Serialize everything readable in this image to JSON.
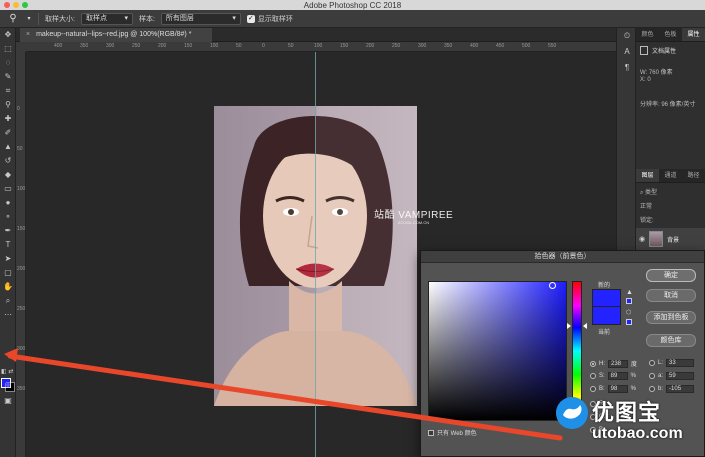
{
  "app": {
    "title": "Adobe Photoshop CC 2018"
  },
  "options_bar": {
    "sample_size_label": "取样大小:",
    "sample_size_value": "取样点",
    "sample_label": "样本:",
    "sample_value": "所有图层",
    "show_ring_label": "显示取样环",
    "show_ring_checked": true
  },
  "document": {
    "tab_title": "makeup--natural--lips--red.jpg @ 100%(RGB/8#) *",
    "tab_close": "×",
    "ruler_h": [
      "400",
      "350",
      "300",
      "250",
      "200",
      "150",
      "100",
      "50",
      "0",
      "50",
      "100",
      "150",
      "200",
      "250",
      "300",
      "350",
      "400",
      "450",
      "500",
      "550"
    ],
    "ruler_v": [
      "0",
      "50",
      "100",
      "150",
      "200",
      "250",
      "300",
      "350"
    ],
    "watermark": "站酷 VAMPIREE",
    "watermark_sub": "ZCOOL.COM.CN"
  },
  "panels": {
    "top_tabs": [
      "颜色",
      "色板",
      "属性"
    ],
    "active_tab": "属性",
    "doc_props_label": "文档属性",
    "w_label": "W: 760 像素",
    "x_label": "X: 0",
    "resolution_label": "分辨率: 96 像素/英寸",
    "layer_tabs": [
      "图层",
      "通道",
      "路径"
    ],
    "kind_label": "类型",
    "normal_label": "正常",
    "lock_label": "锁定:",
    "layer_name": "背景"
  },
  "color_picker": {
    "title": "拾色器（前景色）",
    "ok": "确定",
    "cancel": "取消",
    "add_swatch": "添加到色板",
    "color_libraries": "颜色库",
    "new_label": "新的",
    "current_label": "当前",
    "hsb": [
      {
        "label": "H:",
        "value": "238",
        "unit": "度",
        "selected": true
      },
      {
        "label": "S:",
        "value": "89",
        "unit": "%",
        "selected": false
      },
      {
        "label": "B:",
        "value": "98",
        "unit": "%",
        "selected": false
      }
    ],
    "lab": [
      {
        "label": "L:",
        "value": "33"
      },
      {
        "label": "a:",
        "value": "59"
      },
      {
        "label": "b:",
        "value": "-105"
      }
    ],
    "rgb_labels": [
      "R:",
      "G:",
      "B:"
    ],
    "web_only_label": "只有 Web 颜色",
    "current_color": "#2323ff"
  },
  "logo": {
    "title": "优图宝",
    "domain": "utobao.com"
  },
  "colors": {
    "accent_arrow": "#e8472a",
    "foreground_swatch": "#2323ff",
    "logo_blue": "#1e90e8"
  }
}
